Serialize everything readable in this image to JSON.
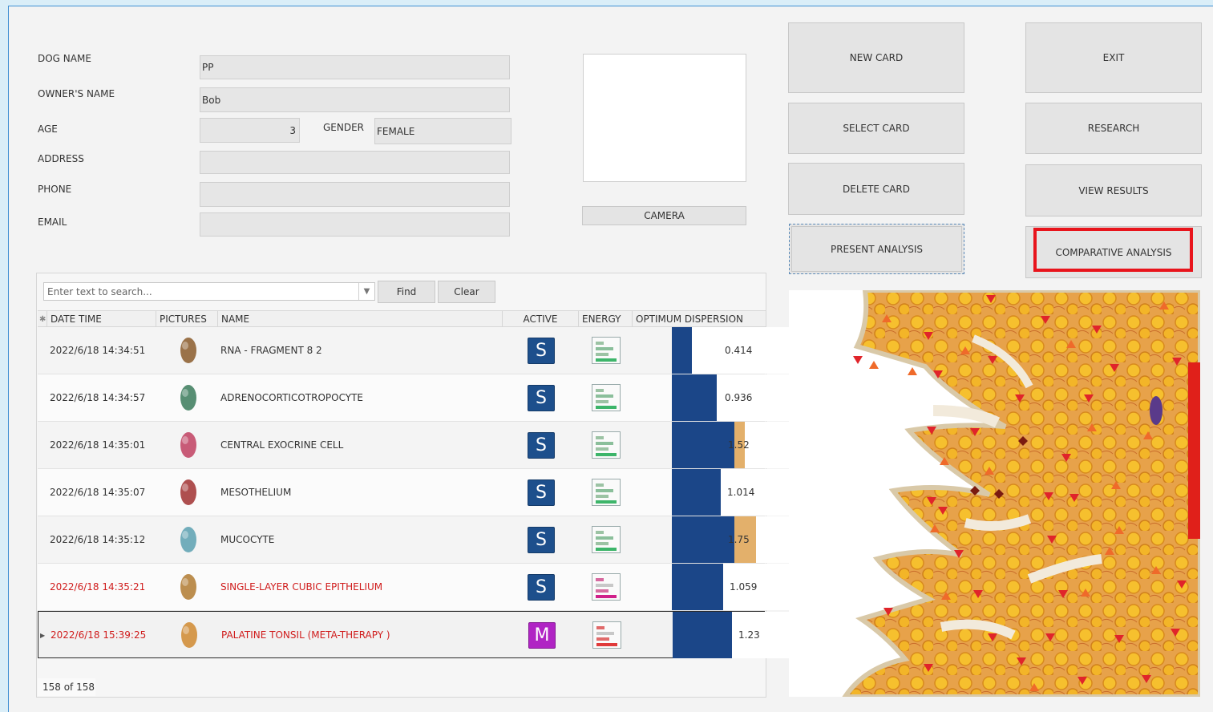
{
  "form": {
    "dog_name_label": "DOG NAME",
    "dog_name_value": "PP",
    "owner_label": "OWNER'S NAME",
    "owner_value": "Bob",
    "age_label": "AGE",
    "age_value": "3",
    "gender_label": "GENDER",
    "gender_value": "FEMALE",
    "address_label": "ADDRESS",
    "address_value": "",
    "phone_label": "PHONE",
    "phone_value": "",
    "email_label": "EMAIL",
    "email_value": ""
  },
  "camera_button": "CAMERA",
  "actions": {
    "new_card": "NEW CARD",
    "exit": "EXIT",
    "select_card": "SELECT CARD",
    "research": "RESEARCH",
    "delete_card": "DELETE CARD",
    "view_results": "VIEW RESULTS",
    "present_analysis": "PRESENT ANALYSIS",
    "comparative_analysis": "COMPARATIVE ANALYSIS"
  },
  "search": {
    "placeholder": "Enter text to search...",
    "find": "Find",
    "clear": "Clear"
  },
  "grid": {
    "columns": [
      "DATE TIME",
      "PICTURES",
      "NAME",
      "ACTIVE",
      "ENERGY",
      "OPTIMUM DISPERSION"
    ],
    "rows": [
      {
        "datetime": "2022/6/18 14:34:51",
        "name": "RNA - FRAGMENT 8 2",
        "active": "S",
        "dispersion": "0.414",
        "dispersion_value": 0.414,
        "highlight": false,
        "energy": "green",
        "selected": false
      },
      {
        "datetime": "2022/6/18 14:34:57",
        "name": "ADRENOCORTICOTROPOCYTE",
        "active": "S",
        "dispersion": "0.936",
        "dispersion_value": 0.936,
        "highlight": false,
        "energy": "green",
        "selected": false
      },
      {
        "datetime": "2022/6/18 14:35:01",
        "name": "CENTRAL EXOCRINE CELL",
        "active": "S",
        "dispersion": "1.52",
        "dispersion_value": 1.52,
        "highlight": false,
        "energy": "green",
        "selected": false
      },
      {
        "datetime": "2022/6/18 14:35:07",
        "name": "MESOTHELIUM",
        "active": "S",
        "dispersion": "1.014",
        "dispersion_value": 1.014,
        "highlight": false,
        "energy": "green",
        "selected": false
      },
      {
        "datetime": "2022/6/18 14:35:12",
        "name": "MUCOCYTE",
        "active": "S",
        "dispersion": "1.75",
        "dispersion_value": 1.75,
        "highlight": false,
        "energy": "green",
        "selected": false
      },
      {
        "datetime": "2022/6/18 14:35:21",
        "name": "SINGLE-LAYER CUBIC EPITHELIUM",
        "active": "S",
        "dispersion": "1.059",
        "dispersion_value": 1.059,
        "highlight": true,
        "energy": "pink",
        "selected": false
      },
      {
        "datetime": "2022/6/18 15:39:25",
        "name": "PALATINE TONSIL (META-THERAPY )",
        "active": "M",
        "dispersion": "1.23",
        "dispersion_value": 1.23,
        "highlight": true,
        "energy": "red",
        "selected": true
      }
    ],
    "count": "158 of 158"
  },
  "colors": {
    "badge_s": "#1d4f8c",
    "badge_m": "#b024c4",
    "bar": "#1b4688",
    "bar_extra": "#e3b06b",
    "highlight_text": "#d01c1c",
    "accent_box": "#e8141c"
  }
}
